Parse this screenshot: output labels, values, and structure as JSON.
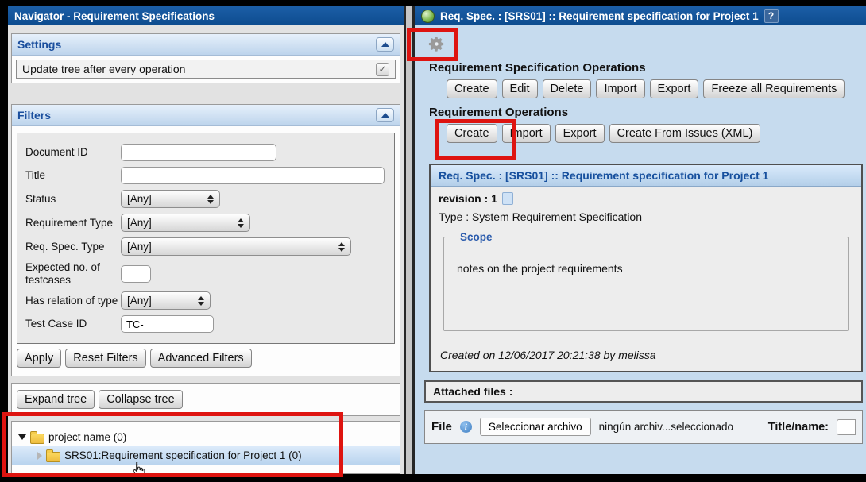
{
  "left_panel": {
    "title": "Navigator - Requirement Specifications",
    "settings": {
      "header": "Settings",
      "update_tree_label": "Update tree after every operation",
      "checkbox_glyph": "✓"
    },
    "filters": {
      "header": "Filters",
      "document_id": {
        "label": "Document ID",
        "value": ""
      },
      "title_field": {
        "label": "Title",
        "value": ""
      },
      "status": {
        "label": "Status",
        "value": "[Any]"
      },
      "requirement_type": {
        "label": "Requirement Type",
        "value": "[Any]"
      },
      "req_spec_type": {
        "label": "Req. Spec. Type",
        "value": "[Any]"
      },
      "expected_testcases": {
        "label": "Expected no. of testcases",
        "value": ""
      },
      "has_relation": {
        "label": "Has relation of type",
        "value": "[Any]"
      },
      "test_case_id": {
        "label": "Test Case ID",
        "value": "TC-"
      },
      "apply_label": "Apply",
      "reset_label": "Reset Filters",
      "advanced_label": "Advanced Filters"
    },
    "tree": {
      "expand_label": "Expand tree",
      "collapse_label": "Collapse tree",
      "root_label": "project name (0)",
      "child_label": "SRS01:Requirement specification for Project 1 (0)"
    }
  },
  "right_panel": {
    "title": "Req. Spec. : [SRS01] :: Requirement specification for Project 1",
    "help_label": "?",
    "spec_operations": {
      "header": "Requirement Specification Operations",
      "buttons": [
        "Create",
        "Edit",
        "Delete",
        "Import",
        "Export",
        "Freeze all Requirements"
      ]
    },
    "req_operations": {
      "header": "Requirement Operations",
      "buttons": [
        "Create",
        "Import",
        "Export",
        "Create From Issues (XML)"
      ]
    },
    "spec_view": {
      "header": "Req. Spec. : [SRS01] :: Requirement specification for Project 1",
      "revision_label": "revision : 1",
      "type_label": "Type : System Requirement Specification",
      "scope_legend": "Scope",
      "scope_text": "notes on the project requirements",
      "created_text": "Created on 12/06/2017 20:21:38  by melissa"
    },
    "attached_files_label": "Attached files :",
    "file_row": {
      "file_label": "File",
      "info_glyph": "i",
      "choose_file_button": "Seleccionar archivo",
      "no_file_text": "ningún archiv...seleccionado",
      "title_name_label": "Title/name:",
      "title_name_value": ""
    }
  },
  "icons": {
    "app_icon": "green-sphere",
    "help_icon": "question-badge",
    "gear_icon": "gear",
    "revision_icon": "document-page",
    "info_icon": "info-circle",
    "folder_icon": "yellow-folder",
    "cursor_icon": "pointing-hand",
    "collapse_icon": "triangle-up",
    "select_arrows_icon": "up-down-arrows"
  },
  "colors": {
    "titlebar_blue": "#0d4c8f",
    "section_header_text": "#1b4f9e",
    "panel_right_bg": "#c6dbee",
    "box_bg": "#ededed",
    "annotation_red": "#de1410",
    "folder_yellow": "#f2c744",
    "selected_row_blue": "#b9d4ee"
  },
  "annotations": {
    "description": "red highlight rectangles over the gear icon, the Requirement Operations Create button, and the requirement tree selection"
  }
}
